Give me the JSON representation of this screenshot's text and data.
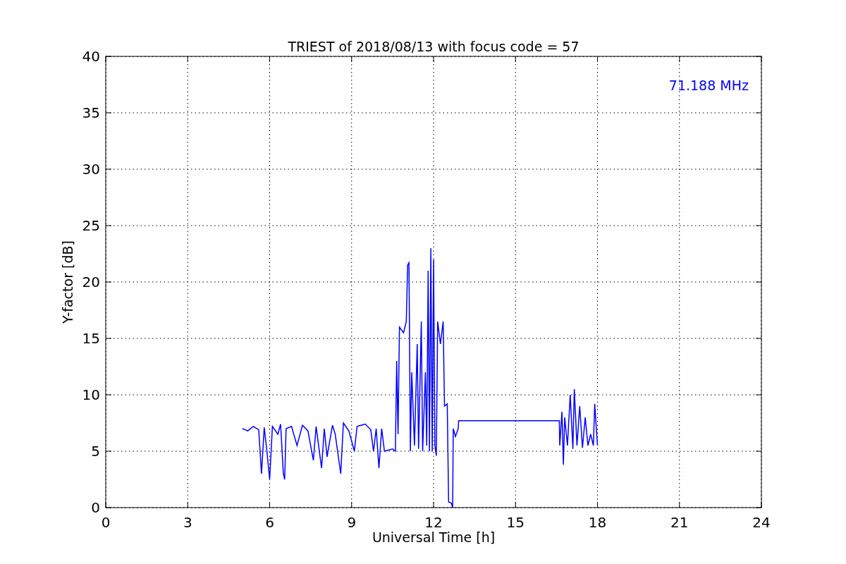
{
  "chart_data": {
    "type": "line",
    "title": "TRIEST of 2018/08/13 with focus code = 57",
    "xlabel": "Universal Time [h]",
    "ylabel": "Y-factor [dB]",
    "x": [
      5.0,
      5.2,
      5.4,
      5.6,
      5.7,
      5.8,
      5.9,
      6.0,
      6.1,
      6.3,
      6.4,
      6.5,
      6.55,
      6.6,
      6.8,
      7.0,
      7.2,
      7.4,
      7.6,
      7.7,
      7.9,
      8.0,
      8.1,
      8.3,
      8.4,
      8.6,
      8.7,
      8.9,
      9.1,
      9.2,
      9.5,
      9.7,
      9.8,
      9.9,
      10.0,
      10.1,
      10.2,
      10.5,
      10.6,
      10.65,
      10.7,
      10.75,
      10.9,
      11.0,
      11.05,
      11.1,
      11.15,
      11.2,
      11.3,
      11.4,
      11.45,
      11.55,
      11.6,
      11.7,
      11.75,
      11.8,
      11.85,
      11.9,
      11.95,
      12.0,
      12.05,
      12.1,
      12.15,
      12.25,
      12.35,
      12.4,
      12.5,
      12.55,
      12.65,
      12.7,
      12.72,
      12.8,
      12.9,
      12.92,
      16.6,
      16.62,
      16.7,
      16.75,
      16.8,
      16.9,
      17.0,
      17.1,
      17.15,
      17.25,
      17.35,
      17.45,
      17.55,
      17.65,
      17.75,
      17.85,
      17.9,
      18.0
    ],
    "series": [
      {
        "color": "#0000ff",
        "values": [
          7.0,
          6.8,
          7.2,
          6.9,
          3.0,
          7.1,
          5.0,
          2.5,
          7.2,
          6.5,
          7.4,
          3.0,
          2.5,
          7.0,
          7.2,
          5.5,
          7.3,
          6.8,
          4.2,
          7.2,
          3.5,
          7.0,
          4.5,
          7.3,
          6.5,
          3.0,
          7.5,
          6.8,
          5.0,
          7.2,
          7.4,
          6.9,
          5.0,
          7.0,
          3.5,
          7.0,
          5.0,
          5.2,
          5.0,
          13.0,
          6.5,
          16.0,
          15.5,
          16.5,
          21.5,
          21.7,
          5.0,
          12.0,
          5.5,
          14.5,
          5.2,
          16.5,
          5.0,
          12.0,
          5.5,
          21.0,
          5.0,
          23.0,
          5.0,
          22.0,
          5.5,
          4.6,
          16.5,
          14.5,
          16.5,
          9.0,
          9.2,
          0.5,
          0.4,
          0.0,
          7.0,
          6.3,
          7.0,
          7.7,
          7.7,
          5.5,
          8.5,
          3.8,
          8.0,
          5.5,
          10.0,
          5.2,
          10.5,
          5.5,
          9.0,
          5.3,
          8.0,
          5.5,
          6.5,
          5.5,
          9.2,
          5.5
        ]
      }
    ],
    "xlim": [
      0,
      24
    ],
    "ylim": [
      0,
      40
    ],
    "xticks": [
      0,
      3,
      6,
      9,
      12,
      15,
      18,
      21,
      24
    ],
    "yticks": [
      0,
      5,
      10,
      15,
      20,
      25,
      30,
      35,
      40
    ],
    "grid": true,
    "annotations": [
      {
        "text": "71.188 MHz"
      }
    ]
  }
}
